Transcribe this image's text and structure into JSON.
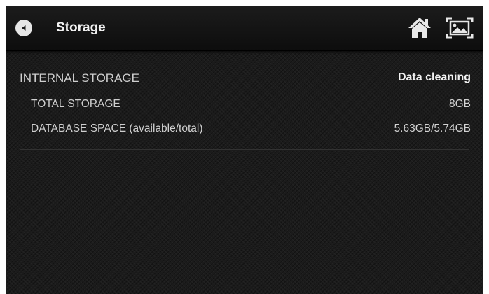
{
  "header": {
    "title": "Storage"
  },
  "icons": {
    "back": "back-arrow-icon",
    "home": "home-icon",
    "gallery": "image-gallery-icon"
  },
  "section": {
    "title": "INTERNAL STORAGE",
    "action_label": "Data cleaning",
    "rows": [
      {
        "label": "TOTAL STORAGE",
        "value": "8GB"
      },
      {
        "label": "DATABASE SPACE (available/total)",
        "value": "5.63GB/5.74GB"
      }
    ]
  },
  "colors": {
    "background": "#1b1b1b",
    "topbar": "#111111",
    "text_primary": "#f2f2f2",
    "text_secondary": "#cfcfcf"
  }
}
